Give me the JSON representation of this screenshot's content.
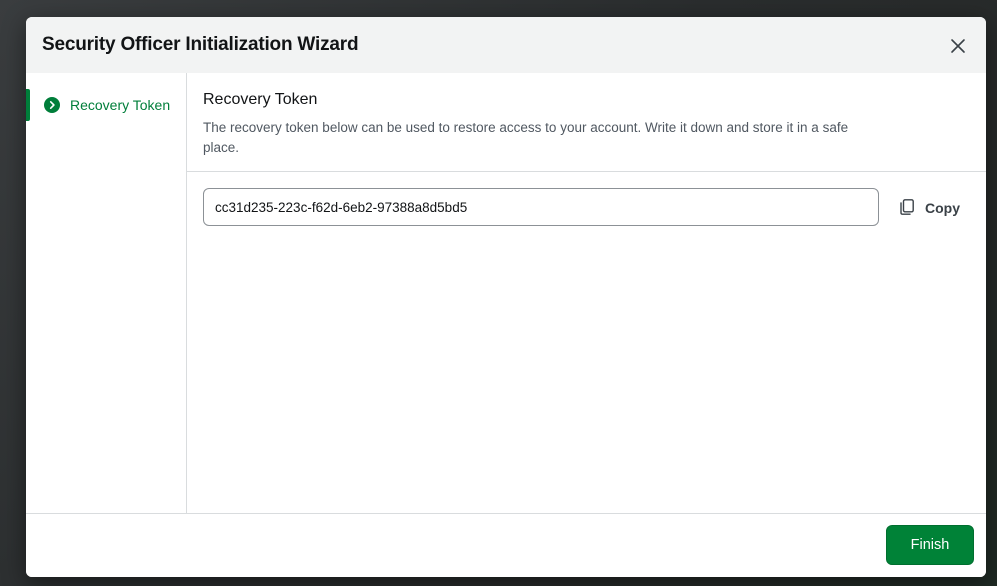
{
  "dialog": {
    "title": "Security Officer Initialization Wizard",
    "close_icon": "close-icon"
  },
  "sidebar": {
    "steps": [
      {
        "label": "Recovery Token",
        "icon": "chevron-right-circle-icon",
        "active": true
      }
    ]
  },
  "content": {
    "title": "Recovery Token",
    "description": "The recovery token below can be used to restore access to your account. Write it down and store it in a safe place.",
    "token_value": "cc31d235-223c-f62d-6eb2-97388a8d5bd5",
    "copy_label": "Copy",
    "copy_icon": "copy-icon"
  },
  "footer": {
    "finish_label": "Finish"
  },
  "colors": {
    "accent": "#007e3a",
    "button_primary": "#008237",
    "header_bg": "#f2f3f3"
  }
}
